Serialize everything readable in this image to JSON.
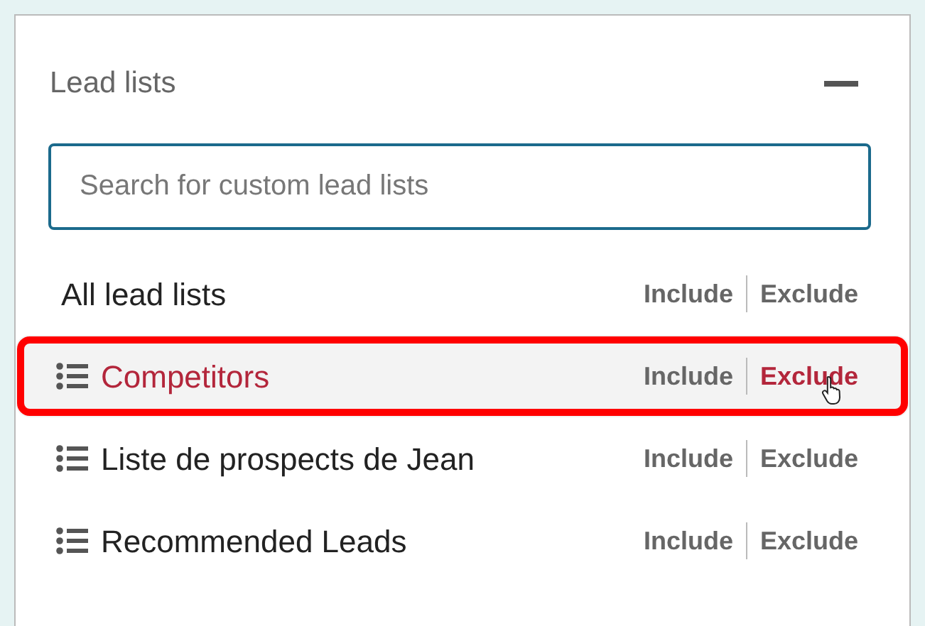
{
  "panel": {
    "title": "Lead lists",
    "expanded": true
  },
  "search": {
    "placeholder": "Search for custom lead lists"
  },
  "rows": [
    {
      "kind": "all",
      "label": "All lead lists",
      "hovered": false,
      "highlighted": false,
      "actions": [
        {
          "label": "Include",
          "hovered": false,
          "pointer": false
        },
        {
          "label": "Exclude",
          "hovered": false,
          "pointer": false
        }
      ]
    },
    {
      "kind": "list",
      "label": "Competitors",
      "hovered": true,
      "highlighted": true,
      "actions": [
        {
          "label": "Include",
          "hovered": false,
          "pointer": false
        },
        {
          "label": "Exclude",
          "hovered": true,
          "pointer": true
        }
      ]
    },
    {
      "kind": "list",
      "label": "Liste de prospects de Jean",
      "hovered": false,
      "highlighted": false,
      "actions": [
        {
          "label": "Include",
          "hovered": false,
          "pointer": false
        },
        {
          "label": "Exclude",
          "hovered": false,
          "pointer": false
        }
      ]
    },
    {
      "kind": "list",
      "label": "Recommended Leads",
      "hovered": false,
      "highlighted": false,
      "actions": [
        {
          "label": "Include",
          "hovered": false,
          "pointer": false
        },
        {
          "label": "Exclude",
          "hovered": false,
          "pointer": false
        }
      ]
    }
  ]
}
